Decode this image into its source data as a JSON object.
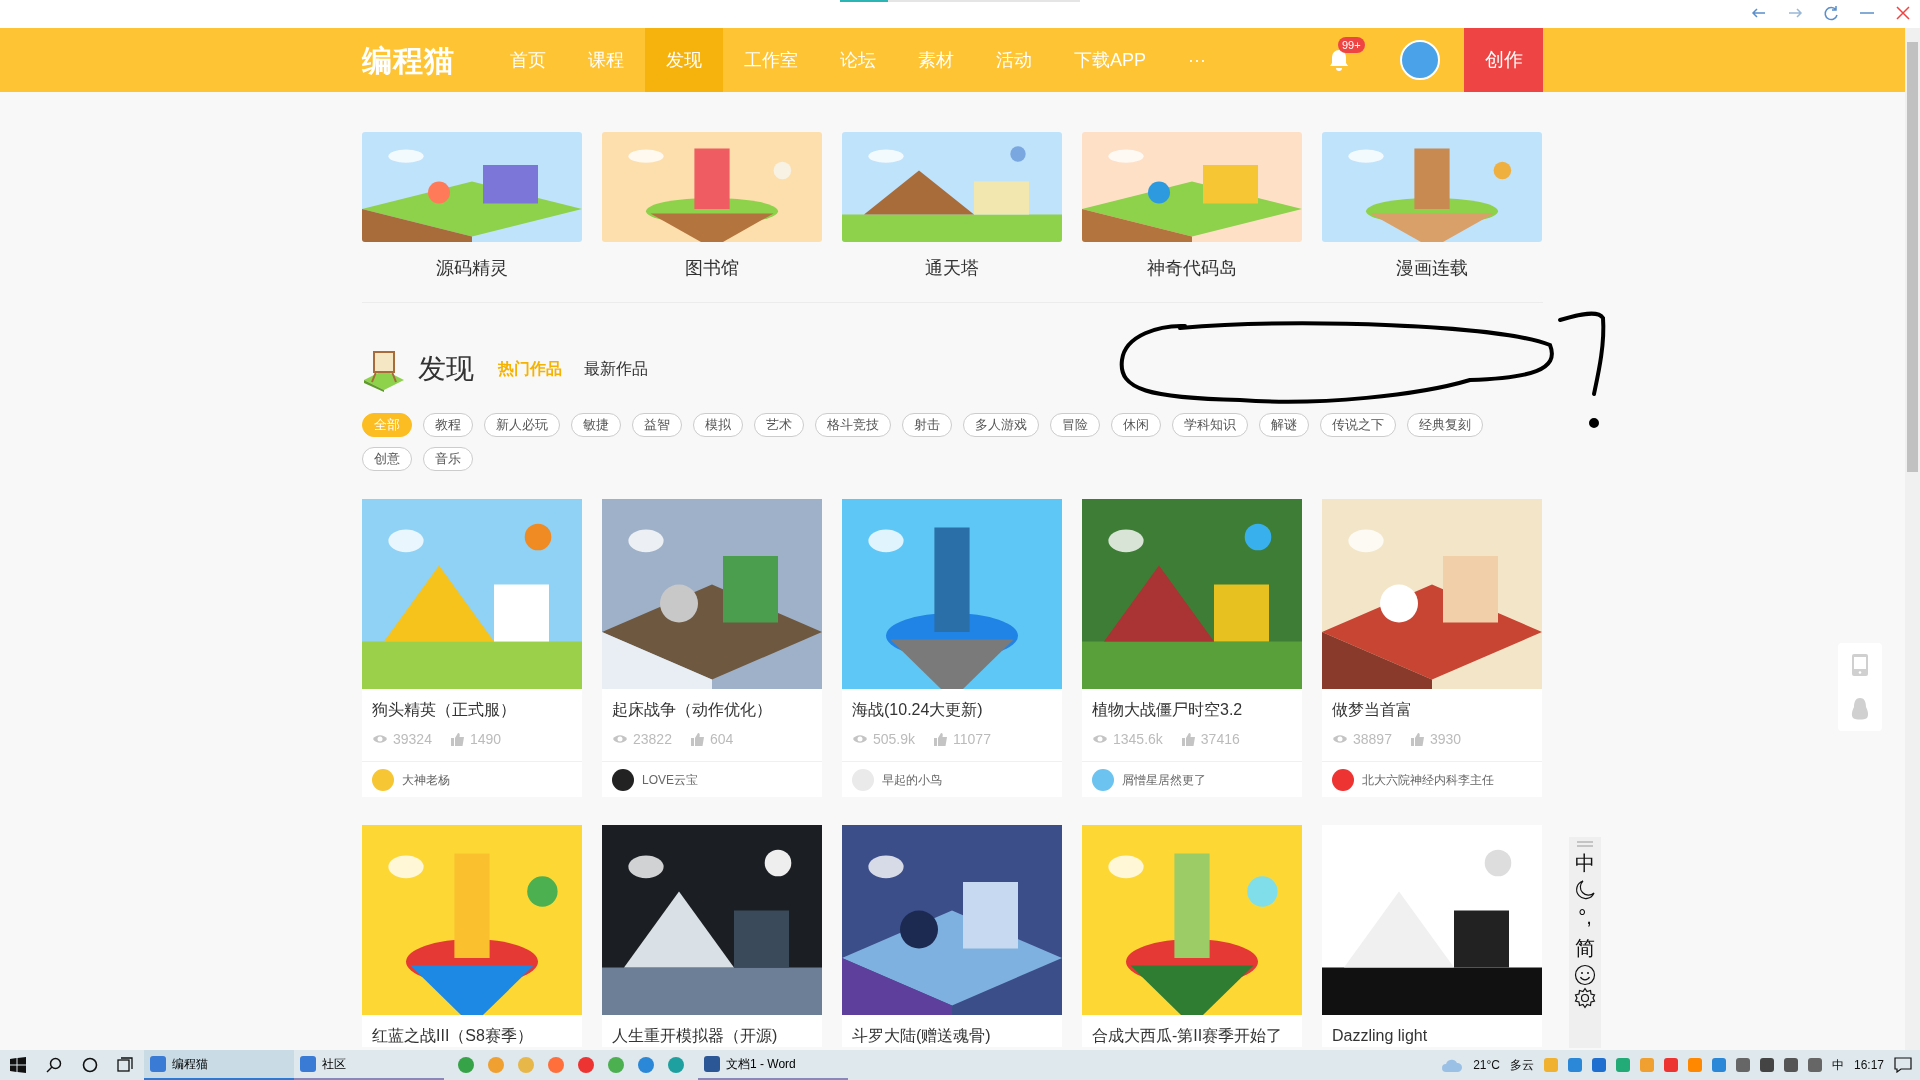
{
  "nav": {
    "logo": "编程猫",
    "items": [
      {
        "label": "首页",
        "selected": false
      },
      {
        "label": "课程",
        "selected": false
      },
      {
        "label": "发现",
        "selected": true
      },
      {
        "label": "工作室",
        "selected": false
      },
      {
        "label": "论坛",
        "selected": false
      },
      {
        "label": "素材",
        "selected": false
      },
      {
        "label": "活动",
        "selected": false
      },
      {
        "label": "下载APP",
        "selected": false
      },
      {
        "label": "···",
        "selected": false
      }
    ],
    "badge": "99+",
    "create_button": "创作"
  },
  "categories": [
    {
      "label": "源码精灵"
    },
    {
      "label": "图书馆"
    },
    {
      "label": "通天塔"
    },
    {
      "label": "神奇代码岛"
    },
    {
      "label": "漫画连载"
    }
  ],
  "discover": {
    "title": "发现",
    "tabs": [
      {
        "label": "热门作品",
        "selected": true
      },
      {
        "label": "最新作品",
        "selected": false
      }
    ]
  },
  "tags": [
    {
      "label": "全部",
      "selected": true
    },
    {
      "label": "教程",
      "selected": false
    },
    {
      "label": "新人必玩",
      "selected": false
    },
    {
      "label": "敏捷",
      "selected": false
    },
    {
      "label": "益智",
      "selected": false
    },
    {
      "label": "模拟",
      "selected": false
    },
    {
      "label": "艺术",
      "selected": false
    },
    {
      "label": "格斗竞技",
      "selected": false
    },
    {
      "label": "射击",
      "selected": false
    },
    {
      "label": "多人游戏",
      "selected": false
    },
    {
      "label": "冒险",
      "selected": false
    },
    {
      "label": "休闲",
      "selected": false
    },
    {
      "label": "学科知识",
      "selected": false
    },
    {
      "label": "解谜",
      "selected": false
    },
    {
      "label": "传说之下",
      "selected": false
    },
    {
      "label": "经典复刻",
      "selected": false
    },
    {
      "label": "创意",
      "selected": false
    },
    {
      "label": "音乐",
      "selected": false
    }
  ],
  "works": [
    {
      "title": "狗头精英（正式服）",
      "views": "39324",
      "likes": "1490",
      "author": "大神老杨"
    },
    {
      "title": "起床战争（动作优化）",
      "views": "23822",
      "likes": "604",
      "author": "LOVE云宝"
    },
    {
      "title": "海战(10.24大更新)",
      "views": "505.9k",
      "likes": "11077",
      "author": "早起的小鸟"
    },
    {
      "title": "植物大战僵尸时空3.2",
      "views": "1345.6k",
      "likes": "37416",
      "author": "屑憎星居然更了"
    },
    {
      "title": "做梦当首富",
      "views": "38897",
      "likes": "3930",
      "author": "北大六院神经内科李主任"
    },
    {
      "title": "红蓝之战III（S8赛季）"
    },
    {
      "title": "人生重开模拟器（开源)"
    },
    {
      "title": "斗罗大陆(赠送魂骨)"
    },
    {
      "title": "合成大西瓜-第II赛季开始了"
    },
    {
      "title": "Dazzling light"
    }
  ],
  "ime_toolbar": {
    "items": [
      {
        "kind": "text",
        "label": "中"
      },
      {
        "kind": "moon"
      },
      {
        "kind": "text",
        "label": "°,"
      },
      {
        "kind": "text",
        "label": "简"
      },
      {
        "kind": "smiley"
      },
      {
        "kind": "gear"
      }
    ]
  },
  "taskbar": {
    "apps": [
      {
        "label": "编程猫",
        "selected": true
      },
      {
        "label": "社区",
        "selected": false
      }
    ],
    "pinned": [
      {
        "label": "文档1 - Word",
        "selected": false
      }
    ],
    "temperature": "21°C",
    "weather": "多云",
    "ime": "中",
    "time": "16:17"
  }
}
